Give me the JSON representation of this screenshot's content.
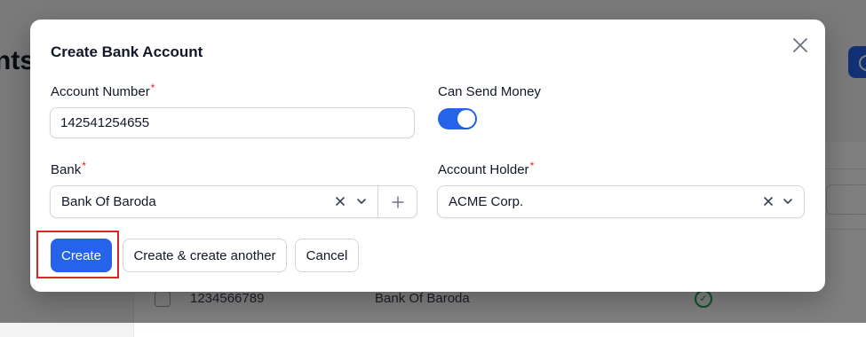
{
  "background": {
    "title_fragment": "nts",
    "row": {
      "account_number": "1234566789",
      "bank": "Bank Of Baroda"
    }
  },
  "modal": {
    "title": "Create Bank Account",
    "account_number": {
      "label": "Account Number",
      "required_mark": "*",
      "value": "142541254655"
    },
    "can_send_money": {
      "label": "Can Send Money",
      "enabled": true
    },
    "bank": {
      "label": "Bank",
      "required_mark": "*",
      "value": "Bank Of Baroda"
    },
    "account_holder": {
      "label": "Account Holder",
      "required_mark": "*",
      "value": "ACME Corp."
    },
    "buttons": {
      "create": "Create",
      "create_another": "Create & create another",
      "cancel": "Cancel"
    }
  },
  "colors": {
    "primary": "#2563eb",
    "required": "#dc2626",
    "highlight": "#dc2626",
    "success": "#16a34a"
  }
}
